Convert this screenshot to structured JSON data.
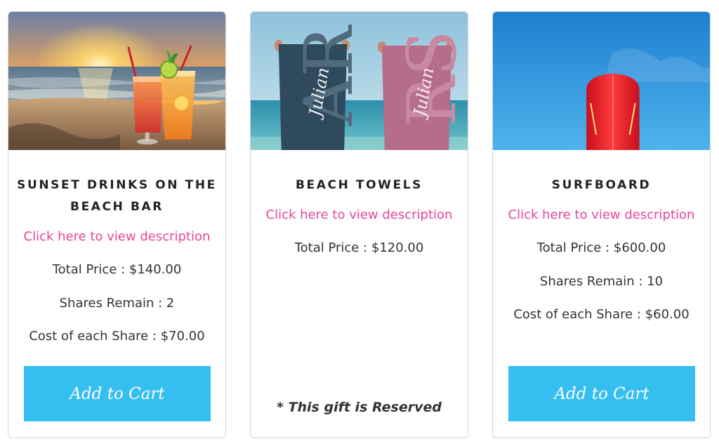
{
  "products": [
    {
      "title": "SUNSET DRINKS ON THE BEACH BAR",
      "image": "sunset-cocktails-on-beach",
      "description_link": "Click here to view description",
      "total_price": "Total Price : $140.00",
      "shares_remain": "Shares Remain : 2",
      "cost_per_share": "Cost of each Share : $70.00",
      "button_label": "Add to Cart"
    },
    {
      "title": "BEACH TOWELS",
      "image": "personalized-beach-towels-julian",
      "towel_text": "Julian",
      "description_link": "Click here to view description",
      "total_price": "Total Price : $120.00",
      "reserved_note": "* This gift is Reserved"
    },
    {
      "title": "SURFBOARD",
      "image": "red-surfboard-blue-sky",
      "description_link": "Click here to view description",
      "total_price": "Total Price : $600.00",
      "shares_remain": "Shares Remain : 10",
      "cost_per_share": "Cost of each Share : $60.00",
      "button_label": "Add to Cart"
    }
  ],
  "colors": {
    "link_pink": "#e8449a",
    "button_blue": "#35bef0",
    "card_border": "#d9d9d9",
    "text_dark": "#333333"
  }
}
